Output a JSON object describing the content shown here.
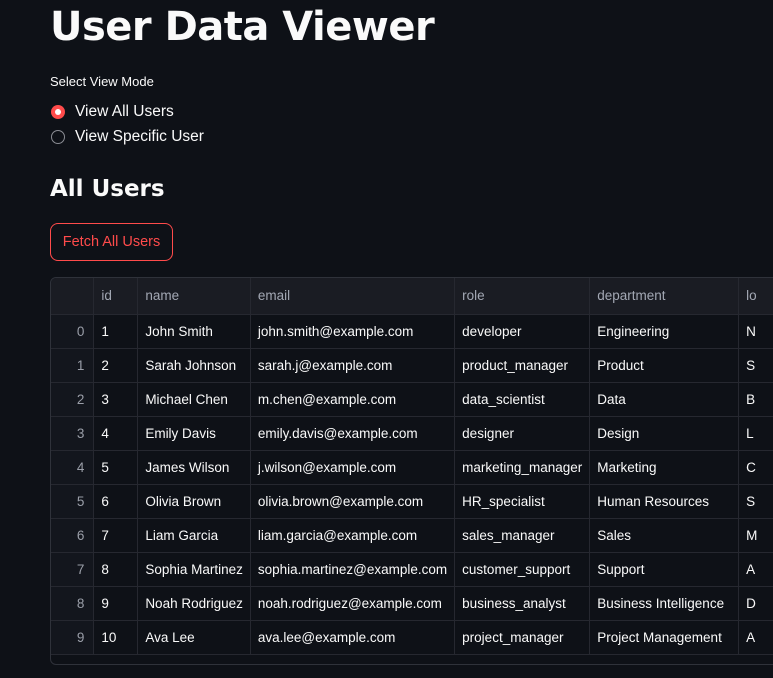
{
  "page": {
    "title": "User Data Viewer"
  },
  "view_mode": {
    "label": "Select View Mode",
    "options": [
      {
        "label": "View All Users",
        "selected": true
      },
      {
        "label": "View Specific User",
        "selected": false
      }
    ]
  },
  "section": {
    "heading": "All Users",
    "fetch_button": "Fetch All Users"
  },
  "table": {
    "columns": [
      "",
      "id",
      "name",
      "email",
      "role",
      "department",
      "lo"
    ],
    "rows": [
      [
        "0",
        "1",
        "John Smith",
        "john.smith@example.com",
        "developer",
        "Engineering",
        "N"
      ],
      [
        "1",
        "2",
        "Sarah Johnson",
        "sarah.j@example.com",
        "product_manager",
        "Product",
        "S"
      ],
      [
        "2",
        "3",
        "Michael Chen",
        "m.chen@example.com",
        "data_scientist",
        "Data",
        "B"
      ],
      [
        "3",
        "4",
        "Emily Davis",
        "emily.davis@example.com",
        "designer",
        "Design",
        "L"
      ],
      [
        "4",
        "5",
        "James Wilson",
        "j.wilson@example.com",
        "marketing_manager",
        "Marketing",
        "C"
      ],
      [
        "5",
        "6",
        "Olivia Brown",
        "olivia.brown@example.com",
        "HR_specialist",
        "Human Resources",
        "S"
      ],
      [
        "6",
        "7",
        "Liam Garcia",
        "liam.garcia@example.com",
        "sales_manager",
        "Sales",
        "M"
      ],
      [
        "7",
        "8",
        "Sophia Martinez",
        "sophia.martinez@example.com",
        "customer_support",
        "Support",
        "A"
      ],
      [
        "8",
        "9",
        "Noah Rodriguez",
        "noah.rodriguez@example.com",
        "business_analyst",
        "Business Intelligence",
        "D"
      ],
      [
        "9",
        "10",
        "Ava Lee",
        "ava.lee@example.com",
        "project_manager",
        "Project Management",
        "A"
      ]
    ]
  },
  "colors": {
    "background": "#0e1117",
    "accent": "#ff4b4b",
    "text": "#fafafa"
  }
}
